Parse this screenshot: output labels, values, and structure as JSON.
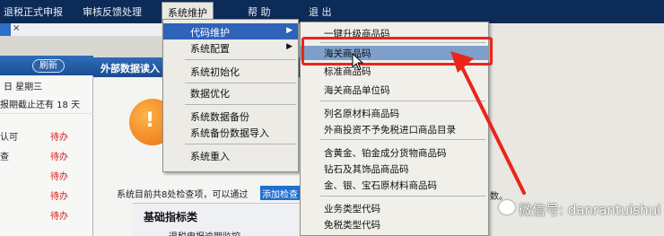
{
  "menubar": {
    "items": [
      {
        "label": "退税正式申报"
      },
      {
        "label": "审核反馈处理"
      },
      {
        "label": "系统维护"
      },
      {
        "label": "帮 助"
      },
      {
        "label": "退 出"
      }
    ]
  },
  "left_panel": {
    "refresh_label": "刷新",
    "date_line": "日 星期三",
    "deadline_line": "报期截止还有 18 天",
    "rows": [
      {
        "label": "认可",
        "status": "待办"
      },
      {
        "label": "查",
        "status": "待办"
      },
      {
        "label": "",
        "status": "待办"
      },
      {
        "label": "",
        "status": "待办"
      },
      {
        "label": "",
        "status": "待办"
      }
    ]
  },
  "center_panel": {
    "title": "外部数据读入",
    "badge_glyph": "!"
  },
  "bottom": {
    "note": "系统目前共8处检查项，可以通过",
    "add_button": "添加检查",
    "basic_title": "基础指标类",
    "basic_sub": "退税申报逾期监控",
    "trail": "数。"
  },
  "menu_system": {
    "items": [
      {
        "label": "代码维护",
        "has_submenu": true,
        "highlighted": true
      },
      {
        "label": "系统配置",
        "has_submenu": true,
        "highlighted": false
      },
      {
        "label": "系统初始化",
        "has_submenu": false,
        "highlighted": false
      },
      {
        "label": "数据优化",
        "has_submenu": false,
        "highlighted": false
      },
      {
        "label": "系统数据备份",
        "has_submenu": false,
        "highlighted": false
      },
      {
        "label": "系统备份数据导入",
        "has_submenu": false,
        "highlighted": false
      },
      {
        "label": "系统重入",
        "has_submenu": false,
        "highlighted": false
      }
    ],
    "arrow_glyph": "▶"
  },
  "menu_code": {
    "items": [
      {
        "label": "一键升级商品码"
      },
      {
        "label": "海关商品码",
        "highlighted": true
      },
      {
        "label": "标准商品码"
      },
      {
        "label": "海关商品单位码"
      },
      {
        "label": "列名原材料商品码"
      },
      {
        "label": "外商投资不予免税进口商品目录"
      },
      {
        "label": "含黄金、铂金成分货物商品码"
      },
      {
        "label": "钻石及其饰品商品码"
      },
      {
        "label": "金、银、宝石原材料商品码"
      },
      {
        "label": "业务类型代码"
      },
      {
        "label": "免税类型代码"
      }
    ]
  },
  "watermark": {
    "text": "微信号: danrantuishui"
  },
  "colors": {
    "menubar_bg": "#0d2b57",
    "highlight": "#2f63b9",
    "annotation_red": "#e8261c",
    "todo_red": "#d21d1d"
  }
}
